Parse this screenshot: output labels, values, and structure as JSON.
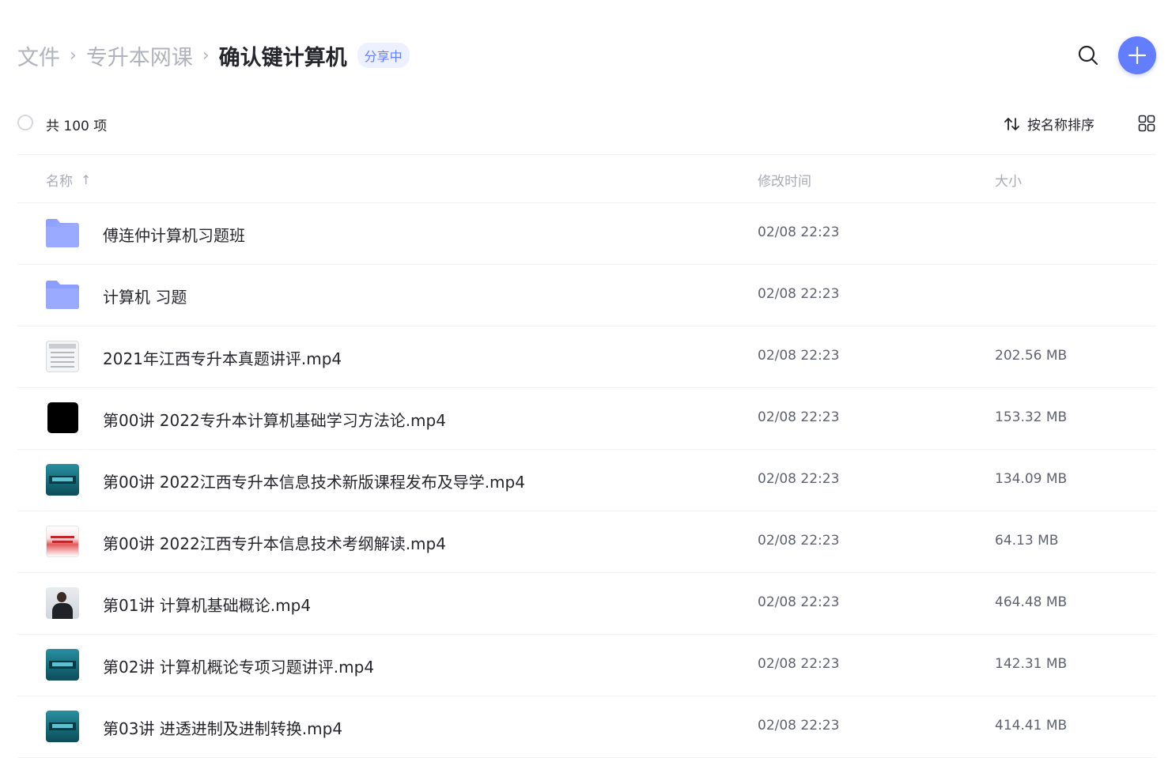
{
  "breadcrumb": {
    "root": "文件",
    "parent": "专升本网课",
    "current": "确认键计算机",
    "separator": "›",
    "badge": "分享中"
  },
  "header": {
    "search_icon": "search-icon",
    "add_icon": "plus-icon",
    "accent_color": "#637dff"
  },
  "toolbar": {
    "count_label": "共 100 项",
    "sort_label": "按名称排序",
    "view_icon": "grid-view-icon"
  },
  "columns": {
    "name": "名称",
    "name_sort_arrow": "↑",
    "modified": "修改时间",
    "size": "大小"
  },
  "files": [
    {
      "name": "傅连仲计算机习题班",
      "time": "02/08 22:23",
      "size": "",
      "thumb": "folder"
    },
    {
      "name": "计算机 习题",
      "time": "02/08 22:23",
      "size": "",
      "thumb": "folder"
    },
    {
      "name": "2021年江西专升本真题讲评.mp4",
      "time": "02/08 22:23",
      "size": "202.56 MB",
      "thumb": "doc"
    },
    {
      "name": "第00讲 2022专升本计算机基础学习方法论.mp4",
      "time": "02/08 22:23",
      "size": "153.32 MB",
      "thumb": "black"
    },
    {
      "name": "第00讲 2022江西专升本信息技术新版课程发布及导学.mp4",
      "time": "02/08 22:23",
      "size": "134.09 MB",
      "thumb": "teal"
    },
    {
      "name": "第00讲 2022江西专升本信息技术考纲解读.mp4",
      "time": "02/08 22:23",
      "size": "64.13 MB",
      "thumb": "red"
    },
    {
      "name": "第01讲 计算机基础概论.mp4",
      "time": "02/08 22:23",
      "size": "464.48 MB",
      "thumb": "person"
    },
    {
      "name": "第02讲 计算机概论专项习题讲评.mp4",
      "time": "02/08 22:23",
      "size": "142.31 MB",
      "thumb": "teal"
    },
    {
      "name": "第03讲 进透进制及进制转换.mp4",
      "time": "02/08 22:23",
      "size": "414.41 MB",
      "thumb": "teal"
    }
  ]
}
